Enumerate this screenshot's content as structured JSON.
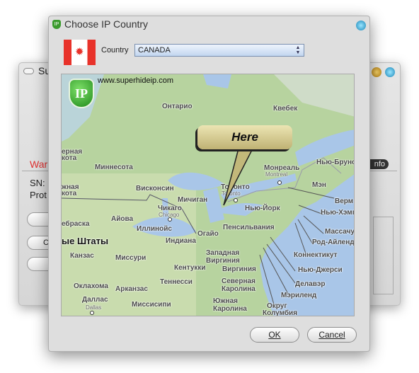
{
  "background_window": {
    "title": "Su",
    "warning": "War",
    "sn_label": "SN:",
    "prot_label": "Prot",
    "button_ch": "Ch",
    "info_label": "nfo"
  },
  "dialog": {
    "title": "Choose IP Country",
    "country_label": "Country",
    "country_value": "CANADA",
    "ok_label": "OK",
    "cancel_label": "Cancel",
    "map": {
      "watermark": "www.superhideip.com",
      "logo": "IP",
      "callout": "Here",
      "labels": [
        "Онтарио",
        "Квебек",
        "Миннесота",
        "ерная",
        "кота",
        "Висконсин",
        "жная",
        "кота",
        "Мичиган",
        "Торонто",
        "Toronto",
        "Монреаль",
        "Montreal",
        "Нью-Брунс",
        "Мэн",
        "Верм",
        "Нью-Хэмп",
        "Массачу",
        "Род-Айленд",
        "Коннектикут",
        "Нью-Джерси",
        "Делавэр",
        "Мэриленд",
        "Округ",
        "Колумбия",
        "Нью-Йорк",
        "Пенсильвания",
        "Огайо",
        "Западная",
        "Виргиния",
        "Виргиния",
        "Северная",
        "Каролина",
        "Южная",
        "Каролина",
        "Кентукки",
        "Теннесси",
        "Миссисипи",
        "Арканзас",
        "Даллас",
        "Dallas",
        "Оклахома",
        "Миссури",
        "Канзас",
        "ые Штаты",
        "Иллинойс",
        "Индиана",
        "Айова",
        "ебраска",
        "Чикаго",
        "Chicago"
      ]
    }
  },
  "colors": {
    "warning": "#e03030",
    "land": "#b7d39f",
    "water": "#a9c6e8",
    "callout": "#d8cf8e"
  }
}
